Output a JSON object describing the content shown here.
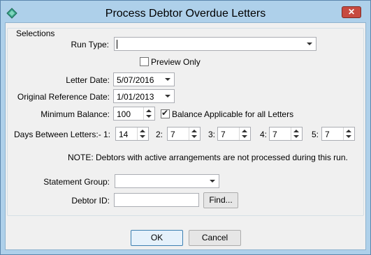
{
  "window": {
    "title": "Process Debtor Overdue Letters",
    "close_label": "✕"
  },
  "selections": {
    "group_label": "Selections",
    "run_type": {
      "label": "Run Type:",
      "value": ""
    },
    "preview_only": {
      "label": "Preview Only",
      "checked": false
    },
    "letter_date": {
      "label": "Letter Date:",
      "value": "5/07/2016"
    },
    "original_reference_date": {
      "label": "Original Reference Date:",
      "value": "1/01/2013"
    },
    "minimum_balance": {
      "label": "Minimum Balance:",
      "value": "100"
    },
    "balance_applicable": {
      "label": "Balance Applicable for all Letters",
      "checked": true
    },
    "days_between": {
      "label": "Days Between Letters:-",
      "items": [
        {
          "label": "1:",
          "value": "14"
        },
        {
          "label": "2:",
          "value": "7"
        },
        {
          "label": "3:",
          "value": "7"
        },
        {
          "label": "4:",
          "value": "7"
        },
        {
          "label": "5:",
          "value": "7"
        }
      ]
    },
    "note": "NOTE:  Debtors with active arrangements are not processed during this run.",
    "statement_group": {
      "label": "Statement Group:",
      "value": ""
    },
    "debtor_id": {
      "label": "Debtor ID:",
      "value": "",
      "find_label": "Find..."
    }
  },
  "buttons": {
    "ok": "OK",
    "cancel": "Cancel"
  }
}
